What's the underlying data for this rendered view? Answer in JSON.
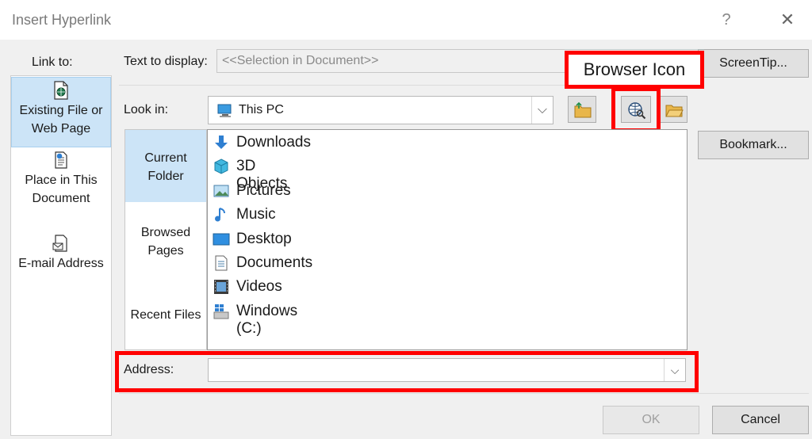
{
  "window": {
    "title": "Insert Hyperlink",
    "help": "?",
    "close": "✕"
  },
  "sidebar": {
    "label": "Link to:",
    "items": [
      {
        "label_a": "Existing File or",
        "label_b": "Web Page",
        "icon": "file-web-icon"
      },
      {
        "label_a": "Place in This",
        "label_b": "Document",
        "icon": "document-place-icon"
      },
      {
        "label_a": "E-mail Address",
        "icon": "email-icon"
      }
    ]
  },
  "text_to_display": {
    "label": "Text to display:",
    "value": "<<Selection in Document>>"
  },
  "screentip": {
    "label": "ScreenTip..."
  },
  "look_in": {
    "label": "Look in:",
    "value": "This PC"
  },
  "annotation": {
    "browser_icon": "Browser Icon"
  },
  "places": [
    "Current Folder",
    "Browsed Pages",
    "Recent Files"
  ],
  "files": [
    "Downloads",
    "3D Objects",
    "Pictures",
    "Music",
    "Desktop",
    "Documents",
    "Videos",
    "Windows (C:)"
  ],
  "bookmark": {
    "label": "Bookmark..."
  },
  "address": {
    "label": "Address:",
    "value": ""
  },
  "buttons": {
    "ok": "OK",
    "cancel": "Cancel"
  },
  "colors": {
    "accent": "#cce4f7",
    "annotation": "#ff0000",
    "folder": "#e8b64a",
    "download": "#2f7fd1"
  }
}
